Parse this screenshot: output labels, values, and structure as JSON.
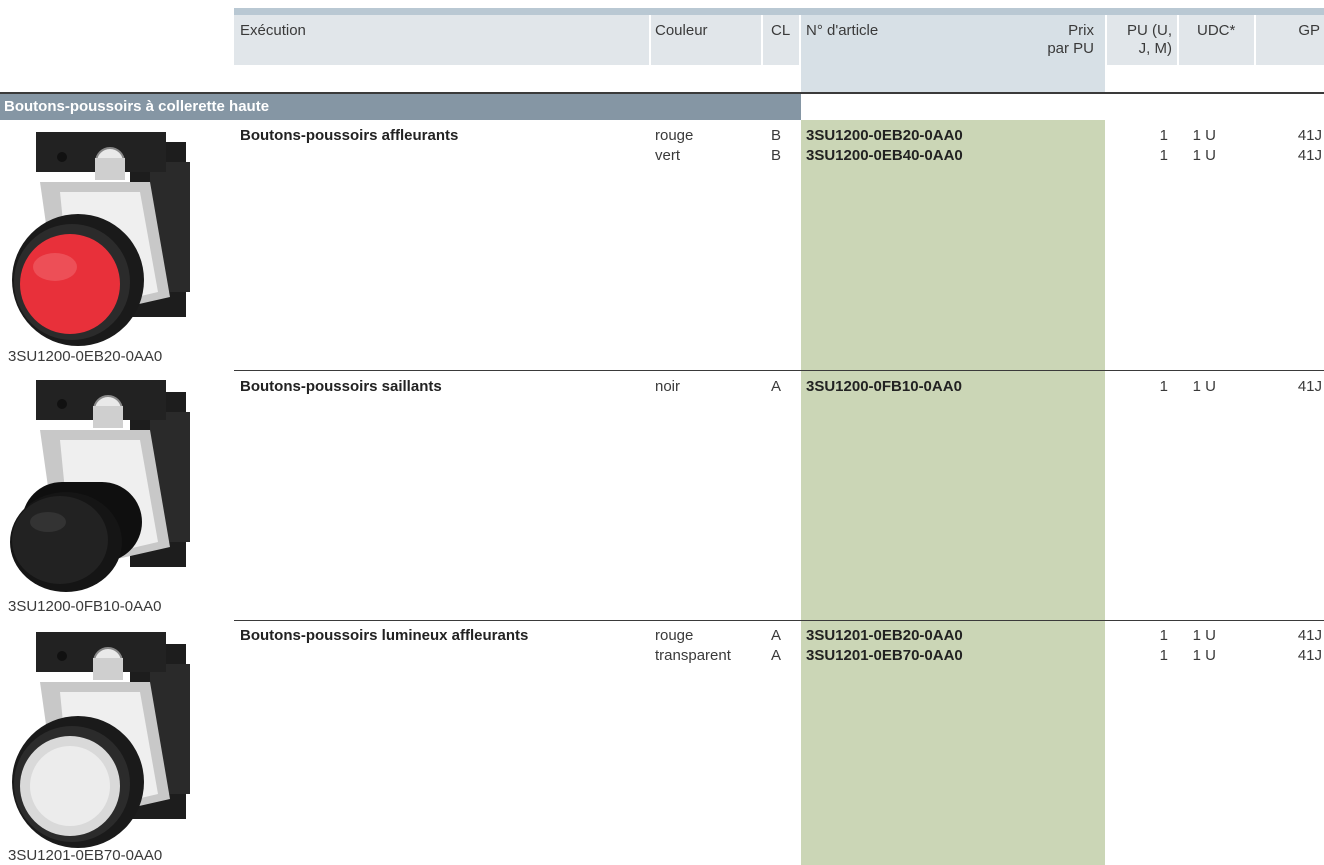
{
  "header": {
    "execution": "Exécution",
    "color": "Couleur",
    "cl": "CL",
    "article": "N° d'article",
    "price": "Prix\npar PU",
    "pu": "PU (U,\nJ, M)",
    "udc": "UDC*",
    "gp": "GP"
  },
  "section_title": "Boutons-poussoirs à collerette haute",
  "groups": [
    {
      "name": "Boutons-poussoirs affleurants",
      "caption": "3SU1200-0EB20-0AA0",
      "button_color": "#e8303a",
      "rows": [
        {
          "color": "rouge",
          "cl": "B",
          "article": "3SU1200-0EB20-0AA0",
          "pu": "1",
          "udc": "1 U",
          "gp": "41J"
        },
        {
          "color": "vert",
          "cl": "B",
          "article": "3SU1200-0EB40-0AA0",
          "pu": "1",
          "udc": "1 U",
          "gp": "41J"
        }
      ]
    },
    {
      "name": "Boutons-poussoirs saillants",
      "caption": "3SU1200-0FB10-0AA0",
      "button_color": "#111111",
      "rows": [
        {
          "color": "noir",
          "cl": "A",
          "article": "3SU1200-0FB10-0AA0",
          "pu": "1",
          "udc": "1 U",
          "gp": "41J"
        }
      ]
    },
    {
      "name": "Boutons-poussoirs lumineux affleurants",
      "caption": "3SU1201-0EB70-0AA0",
      "button_color": "#d9d9d9",
      "rows": [
        {
          "color": "rouge",
          "cl": "A",
          "article": "3SU1201-0EB20-0AA0",
          "pu": "1",
          "udc": "1 U",
          "gp": "41J"
        },
        {
          "color": "transparent",
          "cl": "A",
          "article": "3SU1201-0EB70-0AA0",
          "pu": "1",
          "udc": "1 U",
          "gp": "41J"
        }
      ]
    }
  ]
}
